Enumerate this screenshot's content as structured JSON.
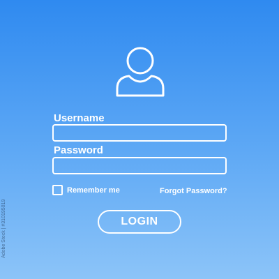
{
  "avatar": {
    "icon": "user-icon"
  },
  "username": {
    "label": "Username",
    "value": "",
    "placeholder": ""
  },
  "password": {
    "label": "Password",
    "value": "",
    "placeholder": ""
  },
  "remember": {
    "label": "Remember me",
    "checked": false
  },
  "forgot": {
    "label": "Forgot Password?"
  },
  "login": {
    "label": "LOGIN"
  },
  "watermark": {
    "text": "Adobe Stock | #310195019"
  },
  "colors": {
    "background_top": "#2f8af0",
    "background_bottom": "#8cc4f8",
    "foreground": "#ffffff"
  }
}
